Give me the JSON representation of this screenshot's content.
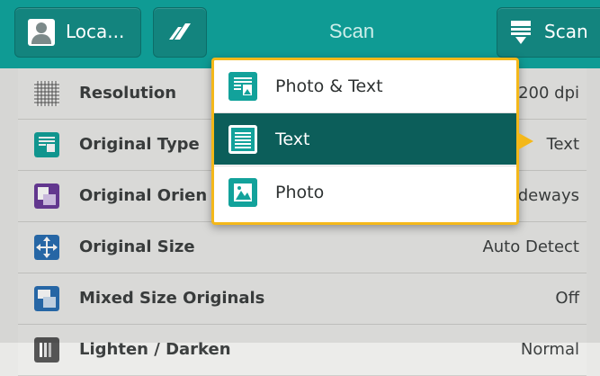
{
  "header": {
    "user_label": "Loca...",
    "title": "Scan",
    "scan_label": "Scan"
  },
  "rows": [
    {
      "label": "Resolution",
      "value": "200 dpi",
      "icon": "grid-icon"
    },
    {
      "label": "Original Type",
      "value": "Text",
      "icon": "original-type-icon"
    },
    {
      "label": "Original Orien",
      "value": "deways",
      "icon": "orientation-icon"
    },
    {
      "label": "Original Size",
      "value": "Auto Detect",
      "icon": "size-icon"
    },
    {
      "label": "Mixed Size Originals",
      "value": "Off",
      "icon": "mixed-size-icon"
    },
    {
      "label": "Lighten / Darken",
      "value": "Normal",
      "icon": "lighten-darken-icon"
    }
  ],
  "dropdown": {
    "options": [
      {
        "label": "Photo & Text",
        "icon": "photo-text-icon",
        "selected": false
      },
      {
        "label": "Text",
        "icon": "text-icon",
        "selected": true
      },
      {
        "label": "Photo",
        "icon": "photo-icon",
        "selected": false
      }
    ]
  },
  "colors": {
    "header": "#0f9b94",
    "accent": "#f4b81a",
    "selected": "#0c5e5a"
  }
}
